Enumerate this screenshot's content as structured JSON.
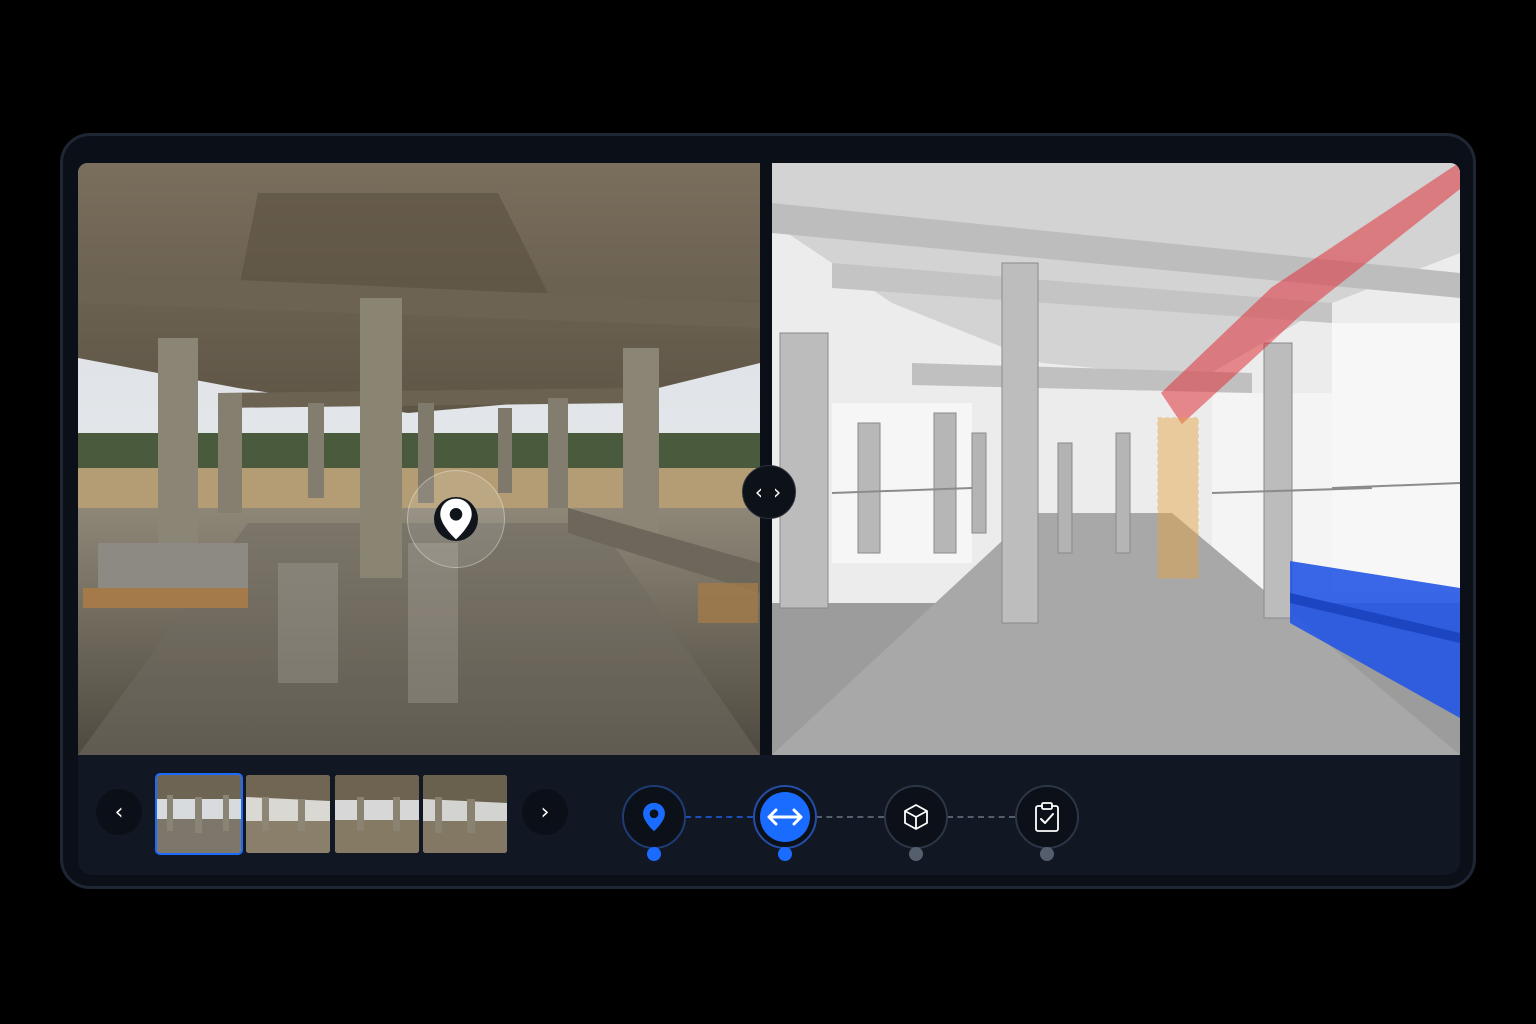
{
  "viewer": {
    "compare_handle_glyph": "‹ ›",
    "left_view": "site-photo",
    "right_view": "bim-model"
  },
  "filmstrip": {
    "prev_glyph": "‹",
    "next_glyph": "›",
    "thumbnails": 4,
    "active_index": 0
  },
  "workflow": {
    "steps": [
      {
        "icon": "map-pin-icon",
        "state": "done"
      },
      {
        "icon": "compare-arrows-icon",
        "state": "active"
      },
      {
        "icon": "3d-cube-icon",
        "state": "pending"
      },
      {
        "icon": "clipboard-check-icon",
        "state": "pending"
      }
    ]
  },
  "colors": {
    "accent": "#1a6bff",
    "clash_red": "#e0333d",
    "clash_orange": "#e6a23c",
    "clash_blue": "#2457e6"
  }
}
